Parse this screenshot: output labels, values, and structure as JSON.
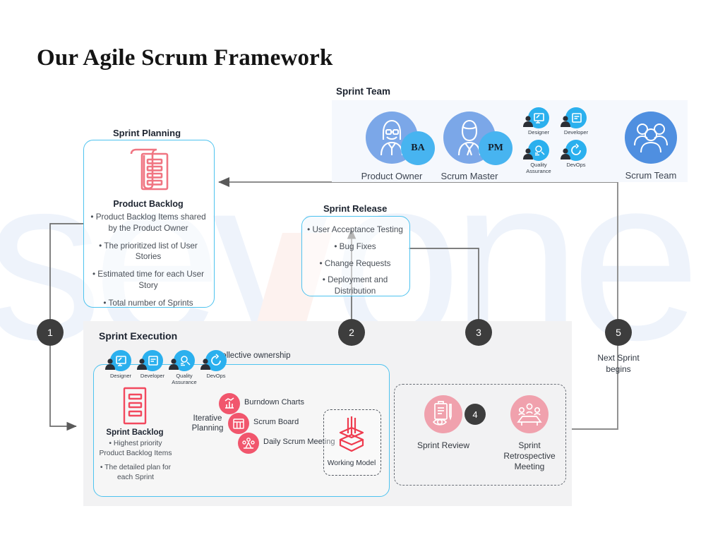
{
  "page": {
    "title": "Our Agile Scrum Framework",
    "watermark": "sevone"
  },
  "colors": {
    "accent_blue": "#4ec3ef",
    "role_blue": "#2bb0ee",
    "person_blue": "#7ba7e8",
    "scrum_team_blue": "#4f8fe0",
    "accent_red": "#f1566d",
    "soft_red": "#f0a1ad",
    "panel_gray": "#f2f2f3",
    "team_panel_bg": "#f5f8fd",
    "step_dark": "#3d3d3d"
  },
  "sprint_team": {
    "label": "Sprint Team",
    "people": [
      {
        "name": "Product Owner",
        "badge": "BA",
        "icon": "person-female-icon"
      },
      {
        "name": "Scrum Master",
        "badge": "PM",
        "icon": "person-male-icon"
      }
    ],
    "roles": [
      {
        "label": "Designer",
        "icon": "designer-icon"
      },
      {
        "label": "Developer",
        "icon": "developer-icon"
      },
      {
        "label": "Quality\nAssurance",
        "line1": "Quality",
        "line2": "Assurance",
        "icon": "quality-assurance-icon"
      },
      {
        "label": "DevOps",
        "line1": "DevOps",
        "line2": "",
        "icon": "devops-icon"
      }
    ],
    "result": {
      "name": "Scrum Team",
      "icon": "people-group-icon"
    },
    "arrow": "arrow-right-icon"
  },
  "sprint_planning": {
    "label": "Sprint Planning",
    "card_title": "Product Backlog",
    "icon": "document-list-icon",
    "bullets": [
      "• Product Backlog Items shared by the Product Owner",
      "• The prioritized list of User Stories",
      "• Estimated time for each User Story",
      "• Total number of Sprints"
    ]
  },
  "sprint_release": {
    "label": "Sprint Release",
    "bullets": [
      "• User Acceptance Testing",
      "• Bug Fixes",
      "• Change Requests",
      "• Deployment and Distribution"
    ]
  },
  "sprint_execution": {
    "label": "Sprint Execution",
    "collective_ownership": "Collective ownership",
    "roles": [
      {
        "line1": "Designer",
        "line2": "",
        "icon": "designer-icon"
      },
      {
        "line1": "Developer",
        "line2": "",
        "icon": "developer-icon"
      },
      {
        "line1": "Quality",
        "line2": "Assurance",
        "icon": "quality-assurance-icon"
      },
      {
        "line1": "DevOps",
        "line2": "",
        "icon": "devops-icon"
      }
    ],
    "backlog_title": "Sprint Backlog",
    "backlog_icon": "list-document-icon",
    "backlog_bullets": [
      "• Highest priority Product Backlog Items",
      "• The detailed plan for each Sprint"
    ],
    "iterative_planning": {
      "line1": "Iterative",
      "line2": "Planning"
    },
    "artifacts": [
      {
        "label": "Burndown Charts",
        "icon": "bar-chart-icon"
      },
      {
        "label": "Scrum Board",
        "icon": "scrum-board-icon"
      },
      {
        "label": "Daily Scrum Meeting",
        "icon": "meeting-people-icon"
      }
    ],
    "working_model": {
      "label": "Working Model",
      "icon": "open-box-icon"
    }
  },
  "review": {
    "sprint_review": {
      "label": "Sprint Review",
      "icon": "clipboard-review-icon"
    },
    "sprint_retrospective": {
      "line1": "Sprint",
      "line2": "Retrospective",
      "line3": "Meeting",
      "icon": "meeting-table-icon"
    }
  },
  "steps": [
    {
      "number": "1"
    },
    {
      "number": "2"
    },
    {
      "number": "3"
    },
    {
      "number": "4"
    },
    {
      "number": "5"
    }
  ],
  "next_sprint": {
    "line1": "Next Sprint",
    "line2": "begins"
  }
}
